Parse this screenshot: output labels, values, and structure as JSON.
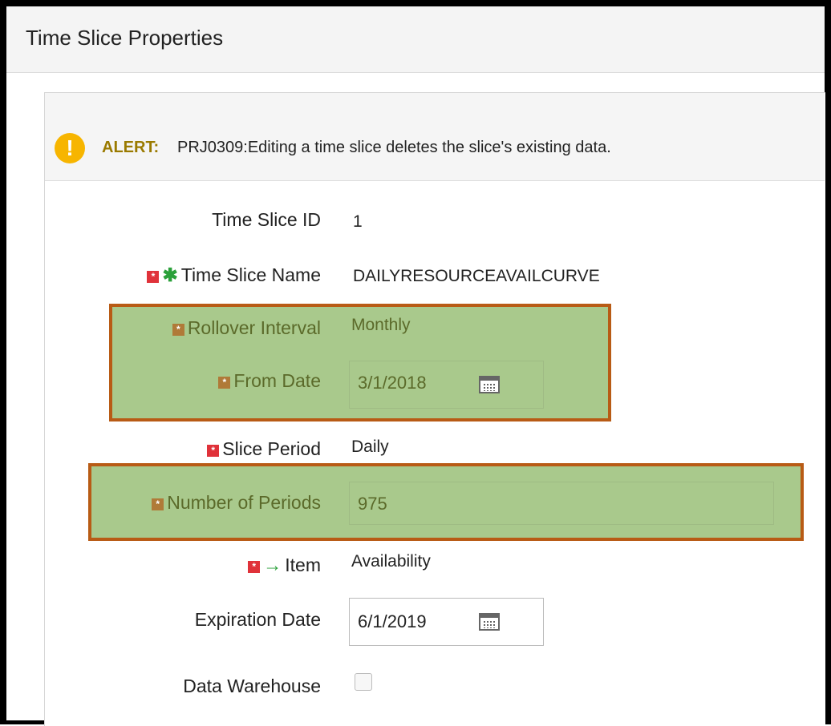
{
  "window": {
    "title": "Time Slice Properties"
  },
  "alert": {
    "icon": "exclamation-icon",
    "prefix": "ALERT:",
    "message": "PRJ0309:Editing a time slice deletes the slice's existing data."
  },
  "fields": {
    "time_slice_id": {
      "label": "Time Slice ID",
      "value": "1"
    },
    "time_slice_name": {
      "label": "Time Slice Name",
      "value": "DAILYRESOURCEAVAILCURVE"
    },
    "rollover_interval": {
      "label": "Rollover Interval",
      "value": "Monthly"
    },
    "from_date": {
      "label": "From Date",
      "value": "3/1/2018",
      "icon": "calendar-icon"
    },
    "slice_period": {
      "label": "Slice Period",
      "value": "Daily"
    },
    "number_of_periods": {
      "label": "Number of Periods",
      "value": "975"
    },
    "item": {
      "label": "Item",
      "value": "Availability"
    },
    "expiration_date": {
      "label": "Expiration Date",
      "value": "6/1/2019",
      "icon": "calendar-icon"
    },
    "data_warehouse": {
      "label": "Data Warehouse",
      "checked": false
    }
  },
  "colors": {
    "required_marker": "#e0323a",
    "highlight_fill": "#a9c98c",
    "highlight_border": "#b85b15",
    "alert_icon": "#f7b500"
  }
}
